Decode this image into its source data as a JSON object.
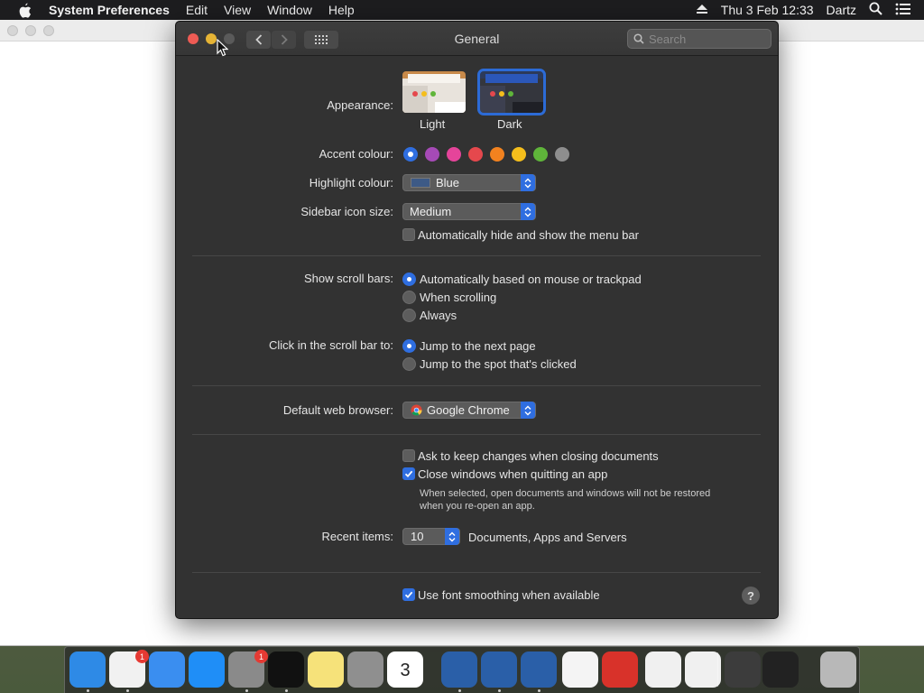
{
  "menubar": {
    "app_name": "System Preferences",
    "items": [
      "Edit",
      "View",
      "Window",
      "Help"
    ],
    "datetime": "Thu 3 Feb  12:33",
    "user": "Dartz",
    "icons": [
      "apple-icon",
      "eject-icon",
      "spotlight-search-icon",
      "control-list-icon"
    ]
  },
  "window": {
    "title": "General",
    "search_placeholder": "Search"
  },
  "appearance": {
    "label": "Appearance:",
    "options": [
      {
        "label": "Light",
        "selected": false
      },
      {
        "label": "Dark",
        "selected": true
      }
    ]
  },
  "accent": {
    "label": "Accent colour:",
    "colors": [
      "#2f6ee0",
      "#a64ab7",
      "#e5449a",
      "#e5484d",
      "#f2821f",
      "#f5be1c",
      "#5fb53a",
      "#8e8e8e"
    ],
    "selected_index": 0
  },
  "highlight": {
    "label": "Highlight colour:",
    "value": "Blue",
    "swatch": "#3d5a86"
  },
  "sidebar_size": {
    "label": "Sidebar icon size:",
    "value": "Medium"
  },
  "auto_hide_menu": {
    "label": "Automatically hide and show the menu bar",
    "checked": false
  },
  "scroll_bars": {
    "label": "Show scroll bars:",
    "options": [
      "Automatically based on mouse or trackpad",
      "When scrolling",
      "Always"
    ],
    "selected_index": 0
  },
  "click_scroll": {
    "label": "Click in the scroll bar to:",
    "options": [
      "Jump to the next page",
      "Jump to the spot that's clicked"
    ],
    "selected_index": 0
  },
  "browser": {
    "label": "Default web browser:",
    "value": "Google Chrome"
  },
  "ask_keep_changes": {
    "label": "Ask to keep changes when closing documents",
    "checked": false
  },
  "close_windows": {
    "label": "Close windows when quitting an app",
    "checked": true,
    "note_line1": "When selected, open documents and windows will not be restored",
    "note_line2": "when you re-open an app."
  },
  "recent_items": {
    "label": "Recent items:",
    "value": "10",
    "suffix": "Documents, Apps and Servers"
  },
  "font_smoothing": {
    "label": "Use font smoothing when available",
    "checked": true
  },
  "help_button": "?",
  "dock": {
    "apps": [
      {
        "name": "Finder",
        "icon": "finder-icon",
        "color": "#2e8ae6",
        "running": true
      },
      {
        "name": "Google Chrome",
        "icon": "chrome-icon",
        "color": "#f1f1f1",
        "running": true,
        "badge": "1"
      },
      {
        "name": "Safari",
        "icon": "safari-icon",
        "color": "#3a8ef0",
        "running": false
      },
      {
        "name": "App Store",
        "icon": "app-store-icon",
        "color": "#1f8ef7",
        "running": false
      },
      {
        "name": "System Preferences",
        "icon": "system-preferences-icon",
        "color": "#8a8a8a",
        "running": true,
        "badge": "1"
      },
      {
        "name": "Terminal",
        "icon": "terminal-icon",
        "color": "#111111",
        "running": true
      },
      {
        "name": "Notes",
        "icon": "notes-icon",
        "color": "#f6e27a",
        "running": false
      },
      {
        "name": "Launchpad",
        "icon": "launchpad-icon",
        "color": "#8f8f8f",
        "running": false
      },
      {
        "name": "Calendar",
        "icon": "calendar-icon",
        "color": "#ffffff",
        "running": false,
        "text": "3"
      },
      {
        "name": "VirtualBox VM 1",
        "icon": "virtualbox-icon",
        "color": "#2a5fa8",
        "running": true
      },
      {
        "name": "VirtualBox VM 2",
        "icon": "virtualbox-icon",
        "color": "#2a5fa8",
        "running": true
      },
      {
        "name": "VirtualBox VM 3",
        "icon": "virtualbox-icon",
        "color": "#2a5fa8",
        "running": true
      },
      {
        "name": "TextEdit",
        "icon": "textedit-icon",
        "color": "#f4f4f4",
        "running": false
      },
      {
        "name": "Burst app",
        "icon": "burst-app-icon",
        "color": "#d8322a",
        "running": false
      },
      {
        "name": "Document 1",
        "icon": "document-icon",
        "color": "#f0f0f0",
        "running": false
      },
      {
        "name": "Document 2",
        "icon": "document-icon",
        "color": "#f0f0f0",
        "running": false
      },
      {
        "name": "Applications",
        "icon": "applications-folder-icon",
        "color": "#3c3c3c",
        "running": false
      },
      {
        "name": "Downloads",
        "icon": "downloads-stack-icon",
        "color": "#222222",
        "running": false
      },
      {
        "name": "Trash",
        "icon": "trash-icon",
        "color": "#b8b8b8",
        "running": false
      }
    ]
  }
}
